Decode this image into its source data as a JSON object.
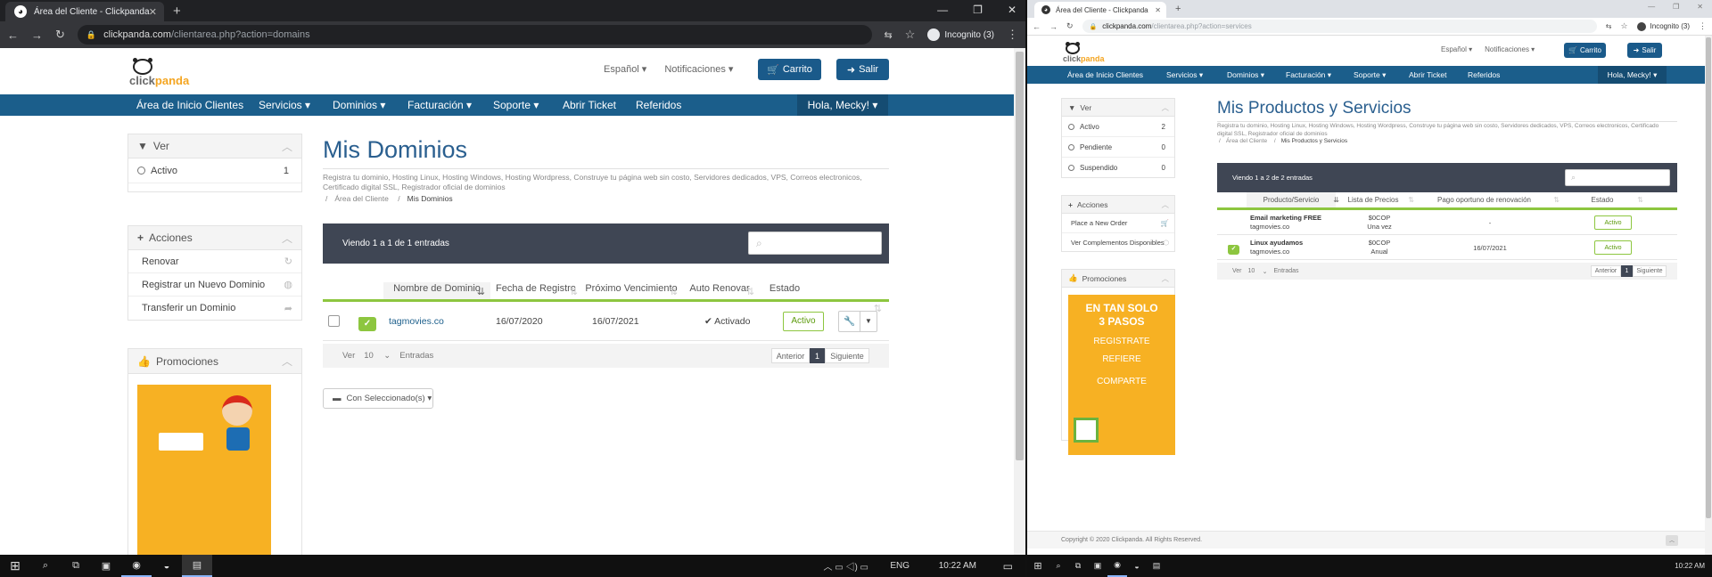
{
  "left": {
    "browser": {
      "tab_title": "Área del Cliente - Clickpanda",
      "url_main": "clickpanda.com",
      "url_rest": "/clientarea.php?action=domains",
      "profile": "Incognito (3)"
    },
    "logo": {
      "part1": "click",
      "part2": "panda"
    },
    "top": {
      "lang": "Español ▾",
      "notif": "Notificaciones ▾",
      "cart": "Carrito",
      "logout": "Salir"
    },
    "nav": {
      "home": "Área de Inicio Clientes",
      "services": "Servicios ▾",
      "domains": "Dominios ▾",
      "billing": "Facturación ▾",
      "support": "Soporte ▾",
      "ticket": "Abrir Ticket",
      "refs": "Referidos",
      "user": "Hola, Mecky! ▾"
    },
    "sidebar": {
      "ver_title": "Ver",
      "ver_items": [
        {
          "label": "Activo",
          "count": "1"
        }
      ],
      "acciones_title": "Acciones",
      "acciones_items": [
        {
          "label": "Renovar"
        },
        {
          "label": "Registrar un Nuevo Dominio"
        },
        {
          "label": "Transferir un Dominio"
        }
      ],
      "promo_title": "Promociones"
    },
    "main": {
      "title": "Mis Dominios",
      "subtitle": "Registra tu dominio, Hosting Linux, Hosting Windows, Hosting Wordpress, Construye tu página web sin costo, Servidores dedicados, VPS, Correos electronicos, Certificado digital SSL, Registrador oficial de dominios",
      "crumb_home": "Área del Cliente",
      "crumb_sep": "/",
      "crumb_current": "Mis Dominios",
      "showing": "Viendo 1 a 1 de 1 entradas",
      "columns": [
        "Nombre de Dominio",
        "Fecha de Registro",
        "Próximo Vencimiento",
        "Auto Renovar",
        "Estado"
      ],
      "rows": [
        {
          "domain": "tagmovies.co",
          "registered": "16/07/2020",
          "expires": "16/07/2021",
          "auto": "✔ Activado",
          "status": "Activo"
        }
      ],
      "ver": "Ver",
      "per_page": "10",
      "entradas": "Entradas",
      "prev": "Anterior",
      "page": "1",
      "next": "Siguiente",
      "bulk": "Con Seleccionado(s) ▾"
    }
  },
  "right": {
    "browser": {
      "tab_title": "Área del Cliente - Clickpanda",
      "url_main": "clickpanda.com",
      "url_rest": "/clientarea.php?action=services",
      "profile": "Incognito (3)"
    },
    "logo": {
      "part1": "click",
      "part2": "panda"
    },
    "top": {
      "lang": "Español ▾",
      "notif": "Notificaciones ▾",
      "cart": "Carrito",
      "logout": "Salir"
    },
    "nav": {
      "home": "Área de Inicio Clientes",
      "services": "Servicios ▾",
      "domains": "Dominios ▾",
      "billing": "Facturación ▾",
      "support": "Soporte ▾",
      "ticket": "Abrir Ticket",
      "refs": "Referidos",
      "user": "Hola, Mecky! ▾"
    },
    "sidebar": {
      "ver_title": "Ver",
      "ver_items": [
        {
          "label": "Activo",
          "count": "2"
        },
        {
          "label": "Pendiente",
          "count": "0"
        },
        {
          "label": "Suspendido",
          "count": "0"
        }
      ],
      "acciones_title": "Acciones",
      "acciones_items": [
        {
          "label": "Place a New Order"
        },
        {
          "label": "Ver Complementos Disponibles"
        }
      ],
      "promo_title": "Promociones",
      "promo_lines": [
        "EN TAN SOLO",
        "3 PASOS",
        "REGISTRATE",
        "REFIERE",
        "COMPARTE"
      ]
    },
    "main": {
      "title": "Mis Productos y Servicios",
      "subtitle": "Registra tu dominio, Hosting Linux, Hosting Windows, Hosting Wordpress, Construye tu página web sin costo, Servidores dedicados, VPS, Correos electronicos, Certificado digital SSL, Registrador oficial de dominios",
      "crumb_home": "Área del Cliente",
      "crumb_sep": "/",
      "crumb_current": "Mis Productos y Servicios",
      "showing": "Viendo 1 a 2 de 2 entradas",
      "columns": [
        "Producto/Servicio",
        "Lista de Precios",
        "Pago oportuno de renovación",
        "Estado"
      ],
      "rows": [
        {
          "name": "Email marketing FREE",
          "domain": "tagmovies.co",
          "price": "$0COP",
          "cycle": "Una vez",
          "due": "-",
          "status": "Activo"
        },
        {
          "name": "Linux ayudamos",
          "domain": "tagmovies.co",
          "price": "$0COP",
          "cycle": "Anual",
          "due": "16/07/2021",
          "status": "Activo"
        }
      ],
      "ver": "Ver",
      "per_page": "10",
      "entradas": "Entradas",
      "prev": "Anterior",
      "page": "1",
      "next": "Siguiente"
    },
    "footer": "Copyright © 2020 Clickpanda. All Rights Reserved."
  },
  "taskbar": {
    "lang": "ENG",
    "time": "10:22 AM",
    "time2": "10:22 AM"
  }
}
